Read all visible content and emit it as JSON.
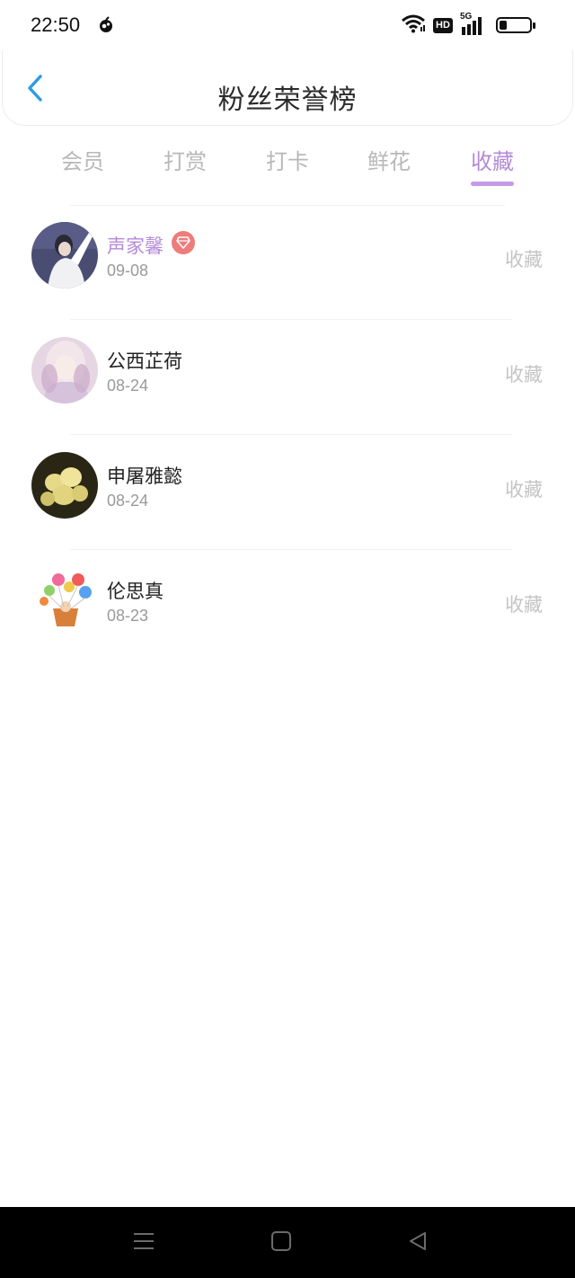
{
  "status_bar": {
    "time": "22:50",
    "icons": [
      "app-notification-icon",
      "wifi-icon",
      "hd-icon",
      "5g-signal-icon",
      "battery-icon"
    ],
    "hd_label": "HD",
    "network_label": "5G"
  },
  "header": {
    "title": "粉丝荣誉榜",
    "back_icon": "chevron-left-icon"
  },
  "tabs": [
    {
      "label": "会员",
      "active": false
    },
    {
      "label": "打赏",
      "active": false
    },
    {
      "label": "打卡",
      "active": false
    },
    {
      "label": "鲜花",
      "active": false
    },
    {
      "label": "收藏",
      "active": true
    }
  ],
  "list": [
    {
      "name": "声家馨",
      "date": "09-08",
      "action": "收藏",
      "vip": true,
      "avatar": "person-photo-avatar"
    },
    {
      "name": "公西芷荷",
      "date": "08-24",
      "action": "收藏",
      "vip": false,
      "avatar": "anime-girl-avatar"
    },
    {
      "name": "申屠雅懿",
      "date": "08-24",
      "action": "收藏",
      "vip": false,
      "avatar": "yellow-flowers-avatar"
    },
    {
      "name": "伦思真",
      "date": "08-23",
      "action": "收藏",
      "vip": false,
      "avatar": "balloons-basket-avatar"
    }
  ],
  "colors": {
    "accent": "#b48ad8",
    "back_arrow": "#2d9be6",
    "vip_badge": "#ef7b7b",
    "inactive_tab": "#b8b8b8",
    "action_text": "#c4c4c4"
  },
  "nav_bar": {
    "buttons": [
      "menu-icon",
      "home-square-icon",
      "back-triangle-icon"
    ]
  }
}
